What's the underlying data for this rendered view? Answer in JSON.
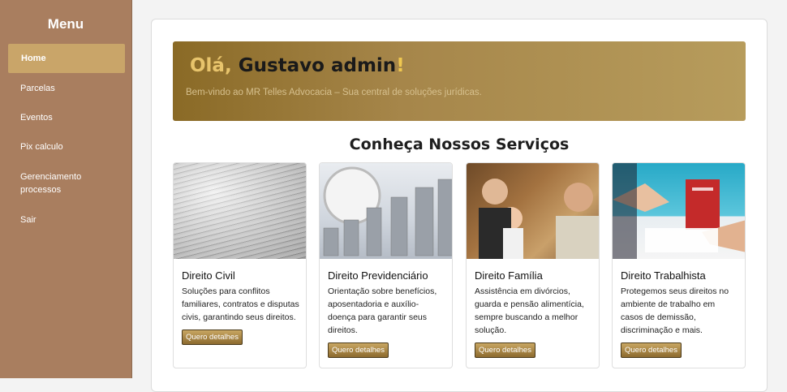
{
  "sidebar": {
    "title": "Menu",
    "items": [
      {
        "label": "Home"
      },
      {
        "label": "Parcelas"
      },
      {
        "label": "Eventos"
      },
      {
        "label": "Pix calculo"
      },
      {
        "label": "Gerenciamento processos"
      },
      {
        "label": "Sair"
      }
    ]
  },
  "hero": {
    "greeting": "Olá,",
    "name": "Gustavo admin",
    "exclaim": "!",
    "subtitle": "Bem-vindo ao MR Telles Advocacia – Sua central de soluções jurídicas."
  },
  "services": {
    "title": "Conheça Nossos Serviços",
    "cards": [
      {
        "title": "Direito Civil",
        "desc": "Soluções para conflitos familiares, contratos e disputas civis, garantindo seus direitos.",
        "button": "Quero detalhes"
      },
      {
        "title": "Direito Previdenciário",
        "desc": "Orientação sobre benefícios, aposentadoria e auxílio-doença para garantir seus direitos.",
        "button": "Quero detalhes"
      },
      {
        "title": "Direito Família",
        "desc": "Assistência em divórcios, guarda e pensão alimentícia, sempre buscando a melhor solução.",
        "button": "Quero detalhes"
      },
      {
        "title": "Direito Trabalhista",
        "desc": "Protegemos seus direitos no ambiente de trabalho em casos de demissão, discriminação e mais.",
        "button": "Quero detalhes"
      }
    ]
  },
  "colors": {
    "sidebar": "#a97e5f",
    "active": "#c9a569",
    "hero_start": "#8a6a26",
    "hero_end": "#b79c5c"
  }
}
